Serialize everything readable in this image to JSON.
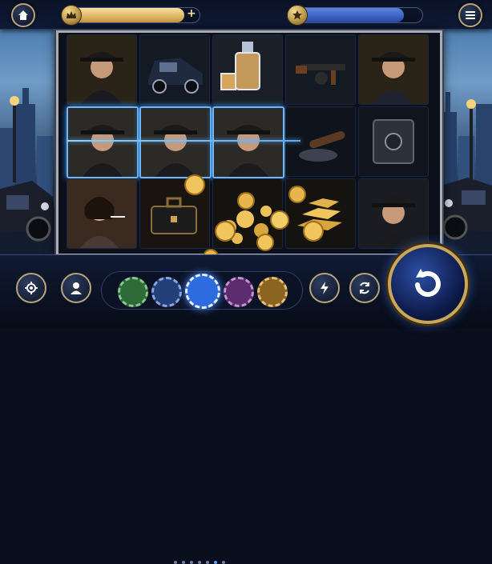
{
  "topbar": {
    "home_icon": "home-icon",
    "menu_icon": "menu-icon",
    "left_meter": {
      "icon": "crown-icon",
      "fill_color": "#e6c16a",
      "level_percent": 88,
      "plus_label": "+"
    },
    "right_meter": {
      "icon": "star-icon",
      "fill_color": "#3f64c8",
      "level_percent": 85
    }
  },
  "reels": {
    "columns": 5,
    "rows": 3,
    "symbols": [
      [
        "gangster-hat",
        "gangster-hat",
        "woman-with-cigarette"
      ],
      [
        "vintage-car",
        "gangster-hat",
        "briefcase"
      ],
      [
        "whiskey-decanter",
        "gangster-hat",
        "gold-coins"
      ],
      [
        "tommy-gun",
        "cigar-ashtray",
        "gold-bars"
      ],
      [
        "detective-hat",
        "safe",
        "gangster-smoking"
      ]
    ],
    "winning_cells": [
      "r2c1",
      "r2c2",
      "r2c3"
    ],
    "winline_color": "#6fb6ff"
  },
  "controls": {
    "settings_icon": "gear-icon",
    "profile_icon": "user-icon",
    "turbo_icon": "lightning-icon",
    "autoplay_icon": "cycle-icon",
    "spin_icon": "spin-arrow-icon",
    "chips": [
      {
        "name": "green",
        "color": "#2f6b39"
      },
      {
        "name": "blue",
        "color": "#24407a"
      },
      {
        "name": "selected-blue",
        "color": "#2c6be0"
      },
      {
        "name": "purple",
        "color": "#5c2c6e"
      },
      {
        "name": "gold",
        "color": "#8a6420"
      }
    ],
    "selected_chip": "selected-blue",
    "page_dots": 7,
    "active_dot": 5
  }
}
